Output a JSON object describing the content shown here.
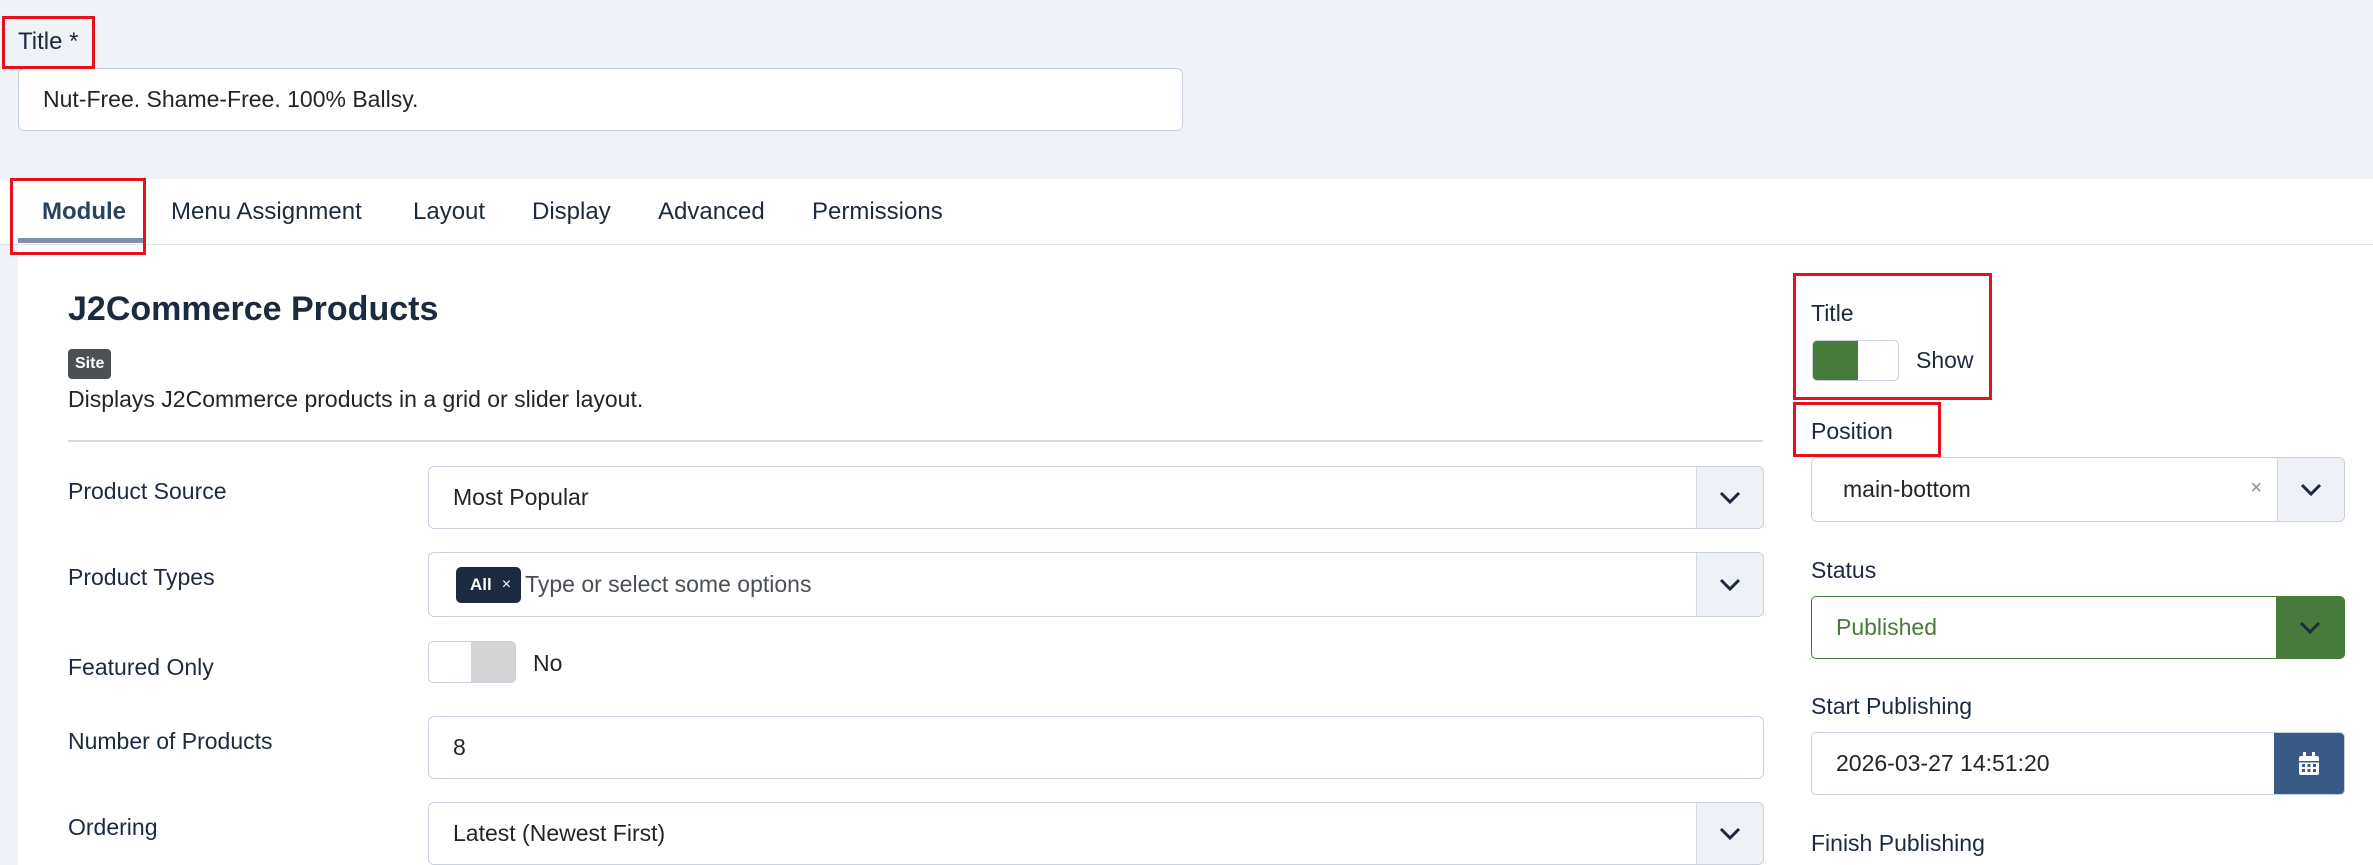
{
  "title_field": {
    "label": "Title *",
    "value": "Nut-Free. Shame-Free. 100% Ballsy."
  },
  "tabs": [
    {
      "label": "Module",
      "active": true
    },
    {
      "label": "Menu Assignment",
      "active": false
    },
    {
      "label": "Layout",
      "active": false
    },
    {
      "label": "Display",
      "active": false
    },
    {
      "label": "Advanced",
      "active": false
    },
    {
      "label": "Permissions",
      "active": false
    }
  ],
  "module": {
    "heading": "J2Commerce Products",
    "badge": "Site",
    "description": "Displays J2Commerce products in a grid or slider layout."
  },
  "fields": {
    "product_source": {
      "label": "Product Source",
      "value": "Most Popular"
    },
    "product_types": {
      "label": "Product Types",
      "tag": "All",
      "tag_remove": "×",
      "placeholder": "Type or select some options"
    },
    "featured_only": {
      "label": "Featured Only",
      "value": "No"
    },
    "number_of_products": {
      "label": "Number of Products",
      "value": "8"
    },
    "ordering": {
      "label": "Ordering",
      "value": "Latest (Newest First)"
    }
  },
  "sidebar": {
    "title": {
      "label": "Title",
      "value": "Show"
    },
    "position": {
      "label": "Position",
      "value": "main-bottom",
      "clear": "×"
    },
    "status": {
      "label": "Status",
      "value": "Published"
    },
    "start_publishing": {
      "label": "Start Publishing",
      "value": "2026-03-27 14:51:20"
    },
    "finish_publishing": {
      "label": "Finish Publishing"
    }
  },
  "icons": {
    "caret": "chevron-down-icon",
    "calendar": "calendar-icon",
    "clear": "close-icon"
  },
  "colors": {
    "accent_green": "#477b3b",
    "accent_blue": "#3a5a86",
    "dark_navy": "#1c2a3f",
    "highlight_red": "#e4121c",
    "page_bg": "#eff2f7"
  }
}
